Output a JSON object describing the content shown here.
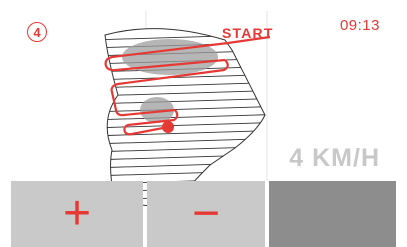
{
  "status": {
    "step_number": "4",
    "time": "09:13",
    "speed": "4 KM/H"
  },
  "map": {
    "start_label": "START"
  },
  "controls": {
    "increase_label": "+",
    "decrease_label": "−"
  },
  "colors": {
    "accent": "#e53935",
    "button_light": "#c9c9c9",
    "button_dark": "#8d8d8d",
    "speed_text": "#c8c8c8"
  }
}
